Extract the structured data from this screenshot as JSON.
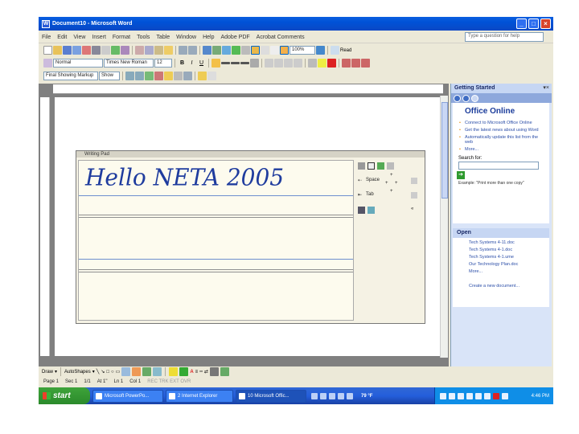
{
  "window": {
    "title": "Document10 - Microsoft Word"
  },
  "menu": [
    "File",
    "Edit",
    "View",
    "Insert",
    "Format",
    "Tools",
    "Table",
    "Window",
    "Help",
    "Adobe PDF",
    "Acrobat Comments"
  ],
  "help_box": {
    "placeholder": "Type a question for help"
  },
  "toolbar2": {
    "zoom": "100%",
    "read": "Read"
  },
  "toolbar3": {
    "style": "Normal",
    "font": "Times New Roman",
    "size": "12"
  },
  "toolbar4": {
    "markup": "Final Showing Markup",
    "show": "Show"
  },
  "writing_pad": {
    "title": "Writing Pad",
    "handwriting": "Hello NETA 2005",
    "space": "Space",
    "tab": "Tab"
  },
  "task_pane": {
    "title": "Getting Started",
    "office_online": "Office Online",
    "links": [
      "Connect to Microsoft Office Online",
      "Get the latest news about using Word",
      "Automatically update this list from the web"
    ],
    "more": "More...",
    "search_label": "Search for:",
    "example": "Example: \"Print more than one copy\"",
    "open_title": "Open",
    "files": [
      "Tech Systems 4-11.doc",
      "Tech Systems 4-1.doc",
      "Tech Systems 4-1.ume",
      "Our Technology Plan.doc"
    ],
    "more_files": "More...",
    "create": "Create a new document..."
  },
  "drawbar": {
    "draw": "Draw",
    "autoshapes": "AutoShapes"
  },
  "status": {
    "page": "Page 1",
    "sec": "Sec 1",
    "pages": "1/1",
    "at": "At 1\"",
    "ln": "Ln 1",
    "col": "Col 1",
    "flags": "REC TRK EXT OVR"
  },
  "taskbar": {
    "start": "start",
    "tasks": [
      "Microsoft PowerPo...",
      "2 Internet Explorer",
      "10 Microsoft Offic..."
    ],
    "temp": "79 °F",
    "clock": "4:46 PM"
  }
}
